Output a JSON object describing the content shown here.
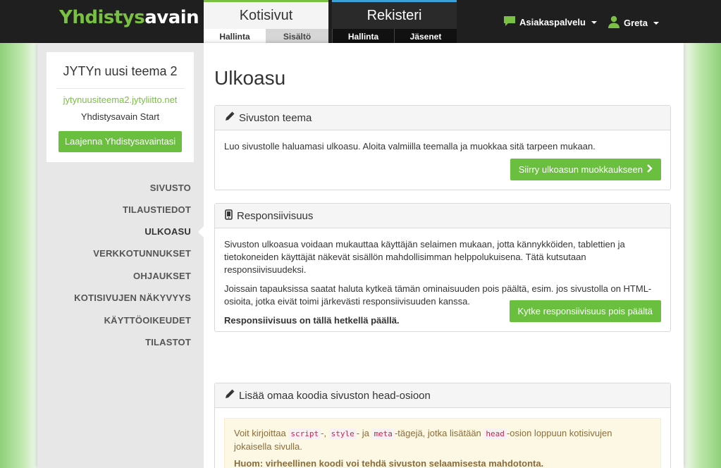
{
  "header": {
    "logo_part1": "Yhdistys",
    "logo_part2": "avain",
    "tabs": [
      {
        "label": "Kotisivut",
        "subtabs": [
          "Hallinta",
          "Sisältö"
        ]
      },
      {
        "label": "Rekisteri",
        "subtabs": [
          "Hallinta",
          "Jäsenet"
        ]
      }
    ],
    "support_label": "Asiakaspalvelu",
    "user_label": "Greta"
  },
  "sidebar": {
    "site_title": "JYTYn uusi teema 2",
    "site_url": "jytynuusiteema2.jytyliitto.net",
    "site_plan": "Yhdistysavain Start",
    "expand_button": "Laajenna Yhdistysavaintasi",
    "nav": [
      "SIVUSTO",
      "TILAUSTIEDOT",
      "ULKOASU",
      "VERKKOTUNNUKSET",
      "OHJAUKSET",
      "KOTISIVUJEN NÄKYVYYS",
      "KÄYTTÖOIKEUDET",
      "TILASTOT"
    ],
    "active_index": 2
  },
  "main": {
    "title": "Ulkoasu",
    "theme_panel": {
      "heading": "Sivuston teema",
      "text": "Luo sivustolle haluamasi ulkoasu. Aloita valmiilla teemalla ja muokkaa sitä tarpeen mukaan.",
      "button": "Siirry ulkoasun muokkaukseen"
    },
    "responsive_panel": {
      "heading": "Responsiivisuus",
      "text1": "Sivuston ulkoasua voidaan mukauttaa käyttäjän selaimen mukaan, jotta kännykköiden, tablettien ja tietokoneiden käyttäjät näkevät sisällön mahdollisimman helppolukuisena. Tätä kutsutaan responsiivisuudeksi.",
      "text2": "Joissain tapauksissa saatat haluta kytkeä tämän ominaisuuden pois päältä, esim. jos sivustolla on HTML-osioita, jotka eivät toimi järkevästi responsiivisuuden kanssa.",
      "status": "Responsiivisuus on tällä hetkellä päällä.",
      "button": "Kytke responsiivisuus pois päältä"
    },
    "head_panel": {
      "heading": "Lisää omaa koodia sivuston head-osioon",
      "warn_pre": "Voit kirjoittaa ",
      "code1": "script",
      "sep1": "-, ",
      "code2": "style",
      "sep2": "- ja ",
      "code3": "meta",
      "warn_mid": "-tägejä, jotka lisätään ",
      "code4": "head",
      "warn_post": "-osion loppuun kotisivujen jokaisella sivulla.",
      "warn_bold": "Huom: virheellinen koodi voi tehdä sivuston selaamisesta mahdotonta."
    }
  },
  "colors": {
    "brand_green": "#7ac143",
    "button_green": "#6abf3f",
    "rekisteri_blue": "#3aa0d8"
  }
}
